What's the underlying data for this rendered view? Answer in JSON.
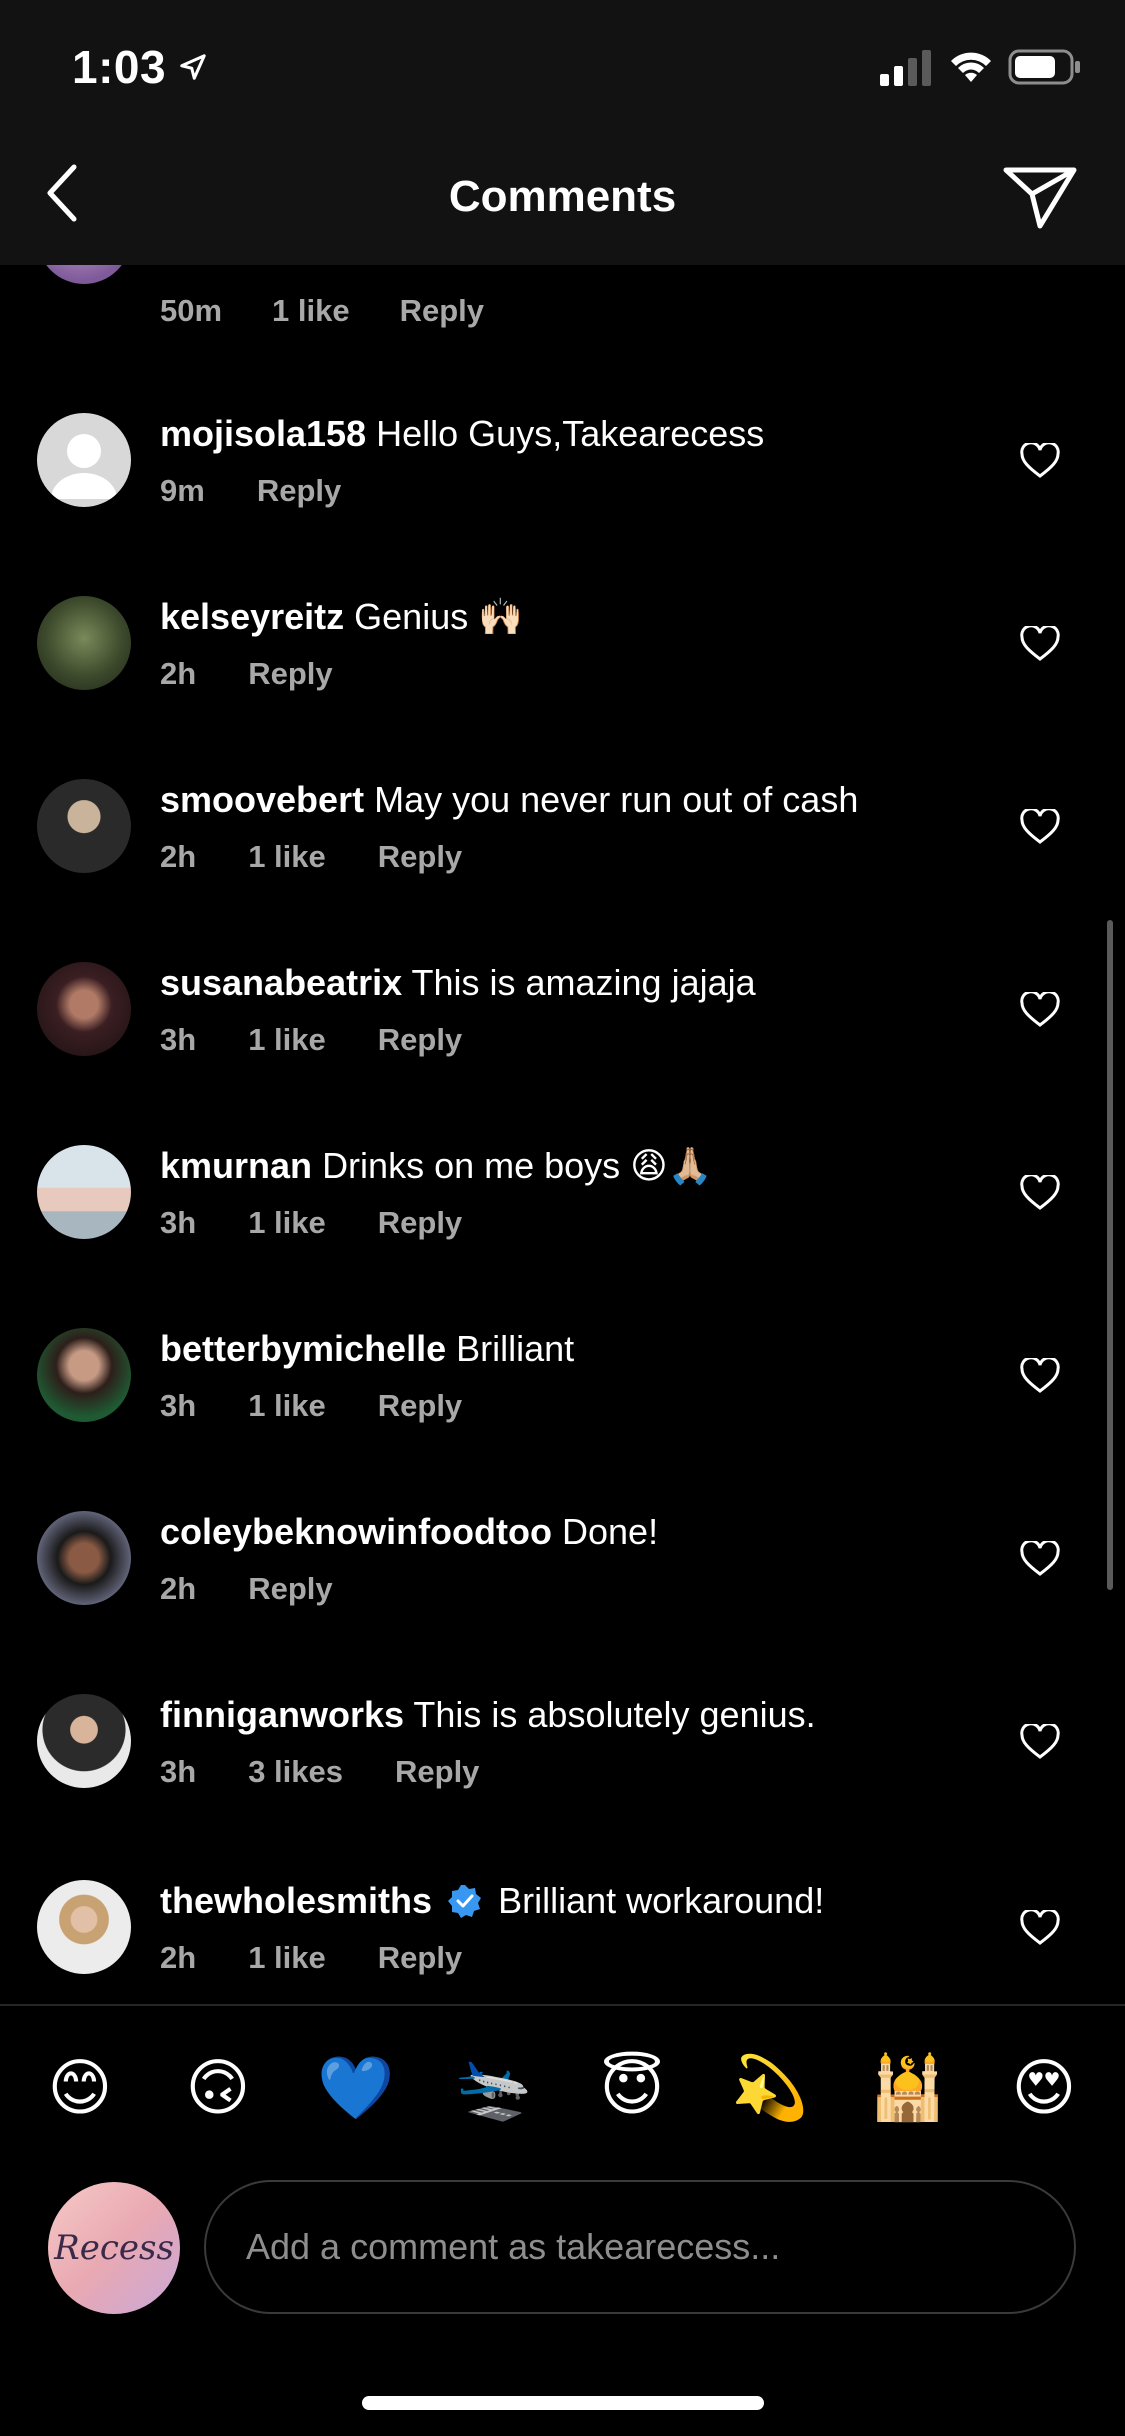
{
  "status_bar": {
    "time": "1:03"
  },
  "nav": {
    "title": "Comments"
  },
  "partial_comment": {
    "time": "50m",
    "likes": "1 like",
    "reply": "Reply"
  },
  "comments": [
    {
      "username": "mojisola158",
      "text": "Hello Guys,Takearecess",
      "time": "9m",
      "likes": "",
      "reply": "Reply",
      "verified": false
    },
    {
      "username": "kelseyreitz",
      "text": "Genius 🙌🏻",
      "time": "2h",
      "likes": "",
      "reply": "Reply",
      "verified": false
    },
    {
      "username": "smoovebert",
      "text": "May you never run out of cash",
      "time": "2h",
      "likes": "1 like",
      "reply": "Reply",
      "verified": false
    },
    {
      "username": "susanabeatrix",
      "text": "This is amazing jajaja",
      "time": "3h",
      "likes": "1 like",
      "reply": "Reply",
      "verified": false
    },
    {
      "username": "kmurnan",
      "text": "Drinks on me boys 😩🙏🏼",
      "time": "3h",
      "likes": "1 like",
      "reply": "Reply",
      "verified": false
    },
    {
      "username": "betterbymichelle",
      "text": "Brilliant",
      "time": "3h",
      "likes": "1 like",
      "reply": "Reply",
      "verified": false
    },
    {
      "username": "coleybeknowinfoodtoo",
      "text": "Done!",
      "time": "2h",
      "likes": "",
      "reply": "Reply",
      "verified": false
    },
    {
      "username": "finniganworks",
      "text": "This is absolutely genius.",
      "time": "3h",
      "likes": "3 likes",
      "reply": "Reply",
      "verified": false
    },
    {
      "username": "thewholesmiths",
      "text": "Brilliant workaround!",
      "time": "2h",
      "likes": "1 like",
      "reply": "Reply",
      "verified": true
    }
  ],
  "emoji_bar": [
    "😊",
    "🙃",
    "💙",
    "🛬",
    "😇",
    "💫",
    "🕌",
    "😍"
  ],
  "composer": {
    "avatar_text": "Recess",
    "placeholder": "Add a comment as takearecess..."
  },
  "colors": {
    "background": "#000000",
    "header": "#121212",
    "secondary_text": "#a8a8a8",
    "verified": "#3897f0"
  }
}
